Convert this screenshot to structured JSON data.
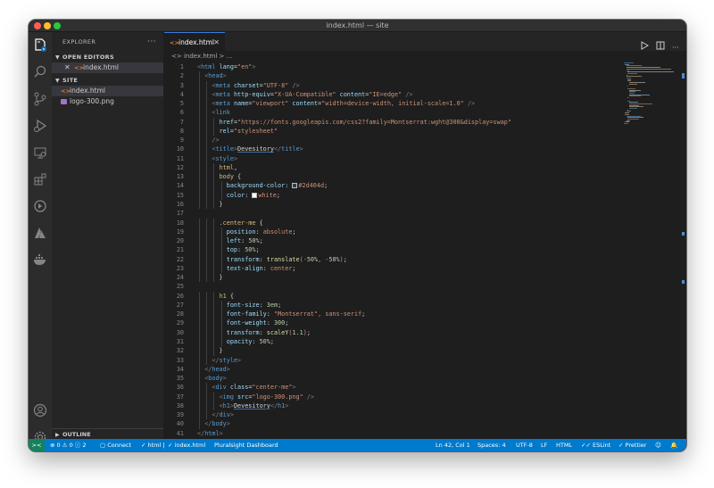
{
  "window": {
    "title": "index.html — site"
  },
  "sidebar": {
    "header": "EXPLORER",
    "more": "···",
    "open_editors_label": "OPEN EDITORS",
    "open_editors": [
      {
        "icon": "<>",
        "name": "index.html"
      }
    ],
    "folder_label": "SITE",
    "files": [
      {
        "icon": "<>",
        "name": "index.html",
        "active": true
      },
      {
        "icon": "image",
        "name": "logo-300.png",
        "active": false
      }
    ],
    "outline_label": "OUTLINE"
  },
  "editor": {
    "tab_icon": "<>",
    "tab_label": "index.html",
    "breadcrumb": "<> index.html > ...",
    "colors": {
      "tag": "#569cd6",
      "attribute": "#9cdcfe",
      "string": "#ce9178",
      "selector": "#d7ba7d",
      "number": "#b5cea8",
      "function": "#dcdcaa"
    }
  },
  "code": [
    "<html lang=\"en\">",
    "  <head>",
    "    <meta charset=\"UTF-8\" />",
    "    <meta http-equiv=\"X-UA-Compatible\" content=\"IE=edge\" />",
    "    <meta name=\"viewport\" content=\"width=device-width, initial-scale=1.0\" />",
    "    <link",
    "      href=\"https://fonts.googleapis.com/css2?family=Montserrat:wght@300&display=swap\"",
    "      rel=\"stylesheet\"",
    "    />",
    "    <title>Devesitory</title>",
    "    <style>",
    "      html,",
    "      body {",
    "        background-color: #2d404d;",
    "        color: white;",
    "      }",
    "",
    "      .center-me {",
    "        position: absolute;",
    "        left: 50%;",
    "        top: 50%;",
    "        transform: translate(-50%, -50%);",
    "        text-align: center;",
    "      }",
    "",
    "      h1 {",
    "        font-size: 3em;",
    "        font-family: \"Montserrat\", sans-serif;",
    "        font-weight: 300;",
    "        transform: scaleY(1.1);",
    "        opacity: 50%;",
    "      }",
    "    </style>",
    "  </head>",
    "  <body>",
    "    <div class=\"center-me\">",
    "      <img src=\"logo-300.png\" />",
    "      <h1>Devesitory</h1>",
    "    </div>",
    "  </body>",
    "</html>"
  ],
  "status": {
    "remote": "><",
    "problems": "⊗ 0 ⚠ 0 ⓘ 2",
    "connect": "Connect",
    "lang_check": "✓ html |",
    "file_check": "✓ index.html",
    "dashboard": "Pluralsight Dashboard",
    "position": "Ln 42, Col 1",
    "spaces": "Spaces: 4",
    "encoding": "UTF-8",
    "eol": "LF",
    "language": "HTML",
    "eslint": "✓✓ ESLint",
    "prettier": "✓ Prettier"
  }
}
